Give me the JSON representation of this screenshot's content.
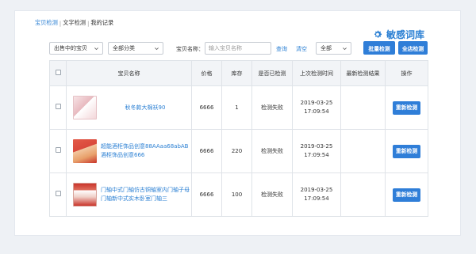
{
  "tabs": {
    "items": [
      "宝贝检测",
      "文字检测",
      "我的记录"
    ],
    "separator": "|"
  },
  "brand": {
    "title": "敏感词库"
  },
  "filters": {
    "status_select": "出售中的宝贝",
    "category_select": "全部分类",
    "name_label": "宝贝名称：",
    "name_placeholder": "输入宝贝名称",
    "query_link": "查询",
    "clear_link": "清空",
    "scope_select": "全部",
    "batch_button": "批量检测",
    "all_button": "全店检测"
  },
  "table": {
    "headers": [
      "宝贝名称",
      "价格",
      "库存",
      "是否已检测",
      "上次检测时间",
      "最新检测结果",
      "操作"
    ],
    "rows": [
      {
        "name": "秋冬款大棉袄90",
        "price": "6666",
        "stock": "1",
        "status": "检测失败",
        "time": "2019-03-25 17:09:54",
        "result": "",
        "action": "重新检测",
        "thumb_color": "#f3d6d9"
      },
      {
        "name": "超能酒柜饰品创意88AAaa68abAB酒柜饰品创意666",
        "price": "6666",
        "stock": "220",
        "status": "检测失败",
        "time": "2019-03-25 17:09:54",
        "result": "",
        "action": "重新检测",
        "thumb_color": "#d9483b"
      },
      {
        "name": "门轴中式门轴仿古铜轴室内门轴子母门轴新中式实木卧室门轴三",
        "price": "6666",
        "stock": "100",
        "status": "检测失败",
        "time": "2019-03-25 17:09:54",
        "result": "",
        "action": "重新检测",
        "thumb_color": "#c9342a"
      }
    ]
  },
  "colors": {
    "accent": "#2f7ed8",
    "link": "#2a7fd3",
    "header_bg": "#f2f4f7"
  }
}
